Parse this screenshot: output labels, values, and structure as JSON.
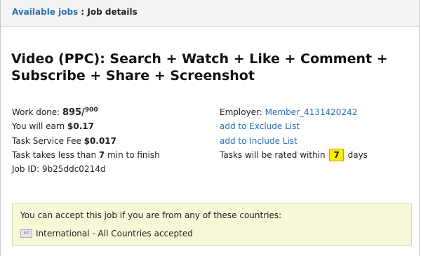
{
  "breadcrumb": {
    "link_label": "Available jobs",
    "separator": " : ",
    "current": "Job details"
  },
  "job": {
    "title": "Video (PPC): Search + Watch + Like + Comment + Subscribe + Share + Screenshot",
    "work_done_label": "Work done: ",
    "work_done_value": "895",
    "work_done_slash": "/",
    "work_total": "900",
    "earn_label": "You will earn ",
    "earn_value": "$0.17",
    "fee_label": "Task Service Fee ",
    "fee_value": "$0.017",
    "time_prefix": "Task takes less than ",
    "time_value": "7",
    "time_suffix": " min to finish",
    "job_id_label": "Job ID: ",
    "job_id_value": "9b25ddc0214d"
  },
  "employer": {
    "label": "Employer: ",
    "name": "Member_4131420242",
    "exclude_link": "add to Exclude List",
    "include_link": "add to Include List",
    "rating_prefix": "Tasks will be rated within ",
    "rating_days": "7",
    "rating_suffix": " days"
  },
  "countries": {
    "heading": "You can accept this job if you are from any of these countries:",
    "flag_icon": "Int",
    "item": "International - All Countries accepted"
  },
  "colors": {
    "link": "#2a6fb0",
    "badge": "#ffeb00",
    "countries_bg": "#f6f8d8"
  }
}
